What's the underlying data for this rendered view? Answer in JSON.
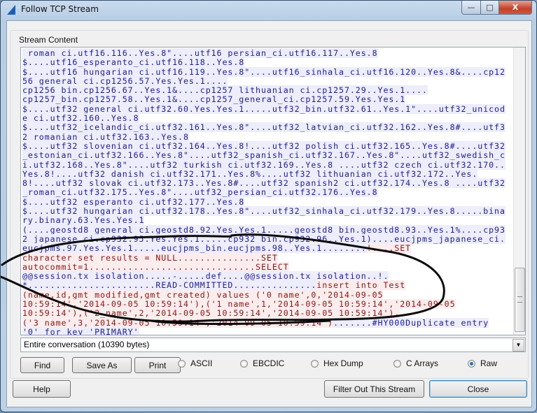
{
  "window": {
    "title": "Follow TCP Stream",
    "controls": [
      "minimize-icon",
      "maximize-icon",
      "close-icon"
    ]
  },
  "group_label": "Stream Content",
  "colors": {
    "server_text": "#1d1d8f",
    "server_bg": "#ededfb",
    "client_text": "#861515",
    "client_bg": "#fbeded"
  },
  "stream_lines": [
    [
      [
        "s",
        "_roman_ci.utf16.116..Yes.8\"....utf16_persian_ci.utf16.117..Yes.8"
      ]
    ],
    [
      [
        "s",
        "$....utf16_esperanto_ci.utf16.118..Yes.8"
      ]
    ],
    [
      [
        "s",
        "$....utf16_hungarian_ci.utf16.119..Yes.8\"....utf16_sinhala_ci.utf16.120..Yes.8&....cp12"
      ]
    ],
    [
      [
        "s",
        "56_general_ci.cp1256.57.Yes.Yes.1...."
      ]
    ],
    [
      [
        "s",
        "cp1256_bin.cp1256.67..Yes.1&....cp1257_lithuanian_ci.cp1257.29..Yes.1...."
      ]
    ],
    [
      [
        "s",
        "cp1257_bin.cp1257.58..Yes.1&....cp1257_general_ci.cp1257.59.Yes.Yes.1"
      ]
    ],
    [
      [
        "s",
        "$....utf32_general_ci.utf32.60.Yes.Yes.1.....utf32_bin.utf32.61..Yes.1\"....utf32_unicod"
      ]
    ],
    [
      [
        "s",
        "e_ci.utf32.160..Yes.8"
      ]
    ],
    [
      [
        "s",
        "$....utf32_icelandic_ci.utf32.161..Yes.8\"....utf32_latvian_ci.utf32.162..Yes.8#....utf3"
      ]
    ],
    [
      [
        "s",
        "2_romanian_ci.utf32.163..Yes.8"
      ]
    ],
    [
      [
        "s",
        "$....utf32_slovenian_ci.utf32.164..Yes.8!....utf32_polish_ci.utf32.165..Yes.8#....utf32"
      ]
    ],
    [
      [
        "s",
        "_estonian_ci.utf32.166..Yes.8\"....utf32_spanish_ci.utf32.167..Yes.8\"....utf32_swedish_c"
      ]
    ],
    [
      [
        "s",
        "i.utf32.168..Yes.8\"....utf32_turkish_ci.utf32.169..Yes.8 ....utf32_czech_ci.utf32.170.."
      ]
    ],
    [
      [
        "s",
        "Yes.8!....utf32_danish_ci.utf32.171..Yes.8%....utf32_lithuanian_ci.utf32.172..Yes."
      ]
    ],
    [
      [
        "s",
        "8!....utf32_slovak_ci.utf32.173..Yes.8#....utf32_spanish2_ci.utf32.174..Yes.8 ....utf32"
      ]
    ],
    [
      [
        "s",
        "_roman_ci.utf32.175..Yes.8\"....utf32_persian_ci.utf32.176..Yes.8"
      ]
    ],
    [
      [
        "s",
        "$....utf32_esperanto_ci.utf32.177..Yes.8"
      ]
    ],
    [
      [
        "s",
        "$....utf32_hungarian_ci.utf32.178..Yes.8\"....utf32_sinhala_ci.utf32.179..Yes.8.....bina"
      ]
    ],
    [
      [
        "s",
        "ry.binary.63.Yes.Yes.1"
      ]
    ],
    [
      [
        "s",
        "(....geostd8_general_ci.geostd8.92.Yes.Yes.1.....geostd8_bin.geostd8.93..Yes.1%....cp93"
      ]
    ],
    [
      [
        "s",
        "2_japanese_ci.cp932.95.Yes.Yes.1.....cp932_bin.cp932.96..Yes.1)....eucjpms_japanese_ci."
      ]
    ],
    [
      [
        "s",
        "eucjpms.97.Yes.Yes.1.....eucjpms_bin.eucjpms.98..Yes.1........"
      ],
      [
        "c",
        "!....SET"
      ]
    ],
    [
      [
        "c",
        "character_set_results = NULL...............SET"
      ]
    ],
    [
      [
        "c",
        "autocommit=1..............................SELECT"
      ]
    ],
    [
      [
        "s",
        "@@session.tx_isolation.....-.....def....@@session.tx_isolation..!."
      ]
    ],
    [
      [
        "s",
        "*.......................READ-COMMITTED..............."
      ],
      [
        "c",
        "insert into Test"
      ]
    ],
    [
      [
        "c",
        "(name,id,gmt_modified,gmt_created) values ('0_name',0,'2014-09-05"
      ]
    ],
    [
      [
        "c",
        "10:59:14','2014-09-05 10:59:14'),('1_name',1,'2014-09-05 10:59:14','2014-09-05"
      ]
    ],
    [
      [
        "c",
        "10:59:14'),('2_name',2,'2014-09-05 10:59:14','2014-09-05 10:59:14'),"
      ]
    ],
    [
      [
        "c",
        "('3_name',3,'2014-09-05 10:59:14','2014-09-05 10:59:14')"
      ],
      [
        "s",
        ".......#HY000Duplicate entry"
      ]
    ],
    [
      [
        "s",
        "'0' for key 'PRIMARY'"
      ]
    ]
  ],
  "conversation_select": {
    "value": "Entire conversation (10390 bytes)"
  },
  "buttons": {
    "find": "Find",
    "save_as": "Save As",
    "print": "Print",
    "help": "Help",
    "filter_out": "Filter Out This Stream",
    "close": "Close"
  },
  "formats": [
    {
      "label": "ASCII",
      "selected": false
    },
    {
      "label": "EBCDIC",
      "selected": false
    },
    {
      "label": "Hex Dump",
      "selected": false
    },
    {
      "label": "C Arrays",
      "selected": false
    },
    {
      "label": "Raw",
      "selected": true
    }
  ]
}
